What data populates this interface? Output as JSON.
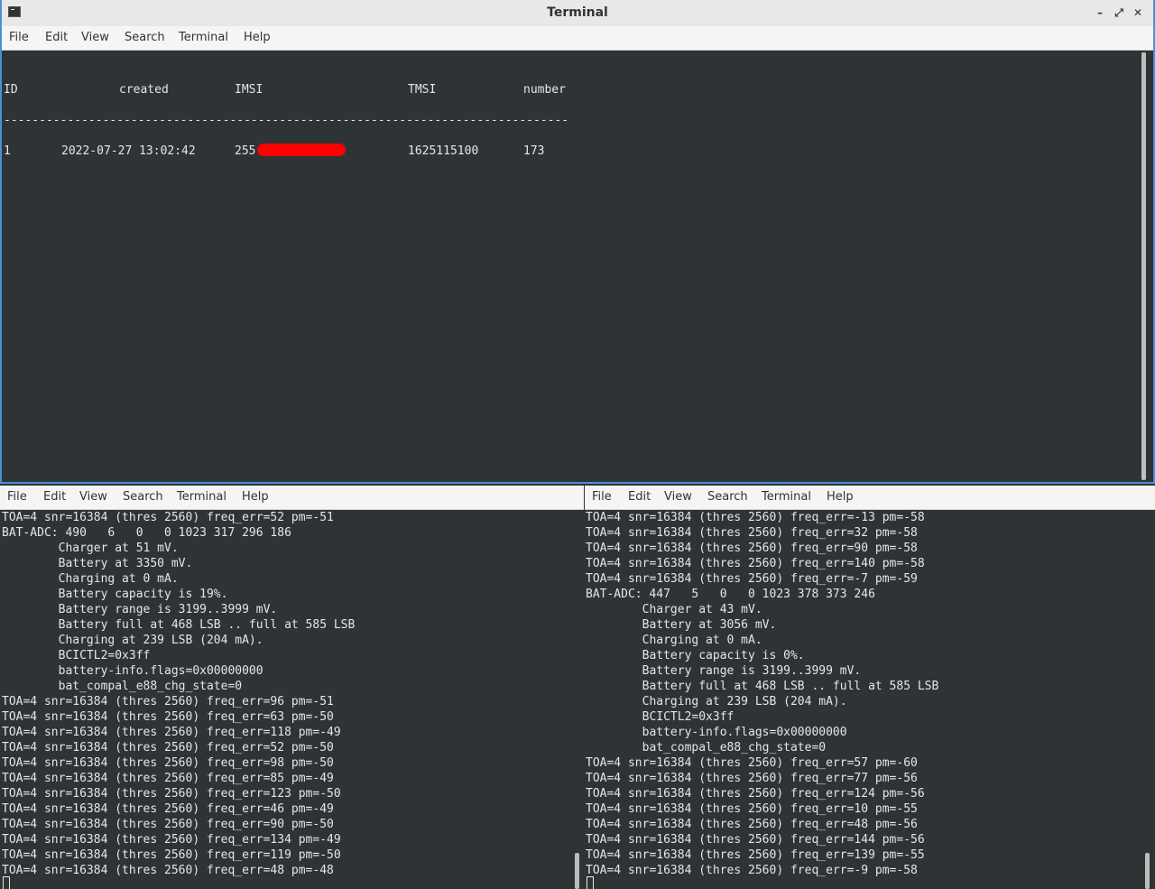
{
  "window": {
    "title": "Terminal"
  },
  "menu": [
    "File",
    "Edit",
    "View",
    "Search",
    "Terminal",
    "Help"
  ],
  "top": {
    "header": [
      "ID",
      "created",
      "IMSI",
      "TMSI",
      "number"
    ],
    "separator": "--------------------------------------------------------------------------------",
    "row": {
      "id": "1",
      "created": "2022-07-27 13:02:42",
      "imsi_prefix": "255",
      "tmsi": "1625115100",
      "number": "173"
    }
  },
  "left_lines": [
    "TOA=4 snr=16384 (thres 2560) freq_err=52 pm=-51",
    "BAT-ADC: 490   6   0   0 1023 317 296 186",
    "        Charger at 51 mV.",
    "        Battery at 3350 mV.",
    "        Charging at 0 mA.",
    "        Battery capacity is 19%.",
    "        Battery range is 3199..3999 mV.",
    "        Battery full at 468 LSB .. full at 585 LSB",
    "        Charging at 239 LSB (204 mA).",
    "        BCICTL2=0x3ff",
    "        battery-info.flags=0x00000000",
    "        bat_compal_e88_chg_state=0",
    "TOA=4 snr=16384 (thres 2560) freq_err=96 pm=-51",
    "TOA=4 snr=16384 (thres 2560) freq_err=63 pm=-50",
    "TOA=4 snr=16384 (thres 2560) freq_err=118 pm=-49",
    "TOA=4 snr=16384 (thres 2560) freq_err=52 pm=-50",
    "TOA=4 snr=16384 (thres 2560) freq_err=98 pm=-50",
    "TOA=4 snr=16384 (thres 2560) freq_err=85 pm=-49",
    "TOA=4 snr=16384 (thres 2560) freq_err=123 pm=-50",
    "TOA=4 snr=16384 (thres 2560) freq_err=46 pm=-49",
    "TOA=4 snr=16384 (thres 2560) freq_err=90 pm=-50",
    "TOA=4 snr=16384 (thres 2560) freq_err=134 pm=-49",
    "TOA=4 snr=16384 (thres 2560) freq_err=119 pm=-50",
    "TOA=4 snr=16384 (thres 2560) freq_err=48 pm=-48"
  ],
  "right_lines": [
    "TOA=4 snr=16384 (thres 2560) freq_err=-13 pm=-58",
    "TOA=4 snr=16384 (thres 2560) freq_err=32 pm=-58",
    "TOA=4 snr=16384 (thres 2560) freq_err=90 pm=-58",
    "TOA=4 snr=16384 (thres 2560) freq_err=140 pm=-58",
    "TOA=4 snr=16384 (thres 2560) freq_err=-7 pm=-59",
    "BAT-ADC: 447   5   0   0 1023 378 373 246",
    "        Charger at 43 mV.",
    "        Battery at 3056 mV.",
    "        Charging at 0 mA.",
    "        Battery capacity is 0%.",
    "        Battery range is 3199..3999 mV.",
    "        Battery full at 468 LSB .. full at 585 LSB",
    "        Charging at 239 LSB (204 mA).",
    "        BCICTL2=0x3ff",
    "        battery-info.flags=0x00000000",
    "        bat_compal_e88_chg_state=0",
    "TOA=4 snr=16384 (thres 2560) freq_err=57 pm=-60",
    "TOA=4 snr=16384 (thres 2560) freq_err=77 pm=-56",
    "TOA=4 snr=16384 (thres 2560) freq_err=124 pm=-56",
    "TOA=4 snr=16384 (thres 2560) freq_err=10 pm=-55",
    "TOA=4 snr=16384 (thres 2560) freq_err=48 pm=-56",
    "TOA=4 snr=16384 (thres 2560) freq_err=144 pm=-56",
    "TOA=4 snr=16384 (thres 2560) freq_err=139 pm=-55",
    "TOA=4 snr=16384 (thres 2560) freq_err=-9 pm=-58"
  ]
}
